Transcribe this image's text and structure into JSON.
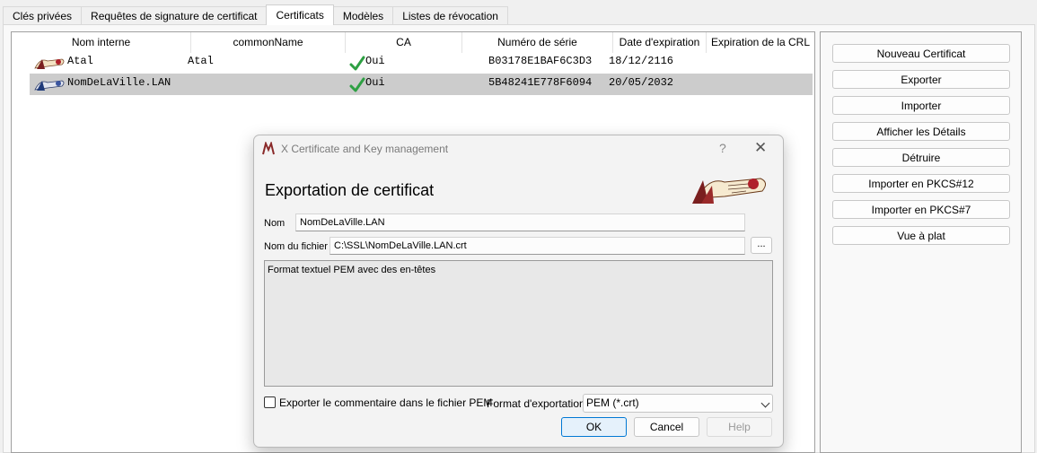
{
  "tabs": [
    "Clés privées",
    "Requêtes de signature de certificat",
    "Certificats",
    "Modèles",
    "Listes de révocation"
  ],
  "active_tab": "Certificats",
  "columns": [
    "Nom interne",
    "commonName",
    "CA",
    "Numéro de série",
    "Date d'expiration",
    "Expiration de la CRL"
  ],
  "rows": [
    {
      "name": "Atal",
      "common_name": "Atal",
      "ca": "Oui",
      "serial": "B03178E1BAF6C3D3",
      "expiration": "18/12/2116",
      "crl": "",
      "selected": false
    },
    {
      "name": "NomDeLaVille.LAN",
      "common_name": "",
      "ca": "Oui",
      "serial": "5B48241E778F6094",
      "expiration": "20/05/2032",
      "crl": "",
      "selected": true
    }
  ],
  "actions": [
    "Nouveau Certificat",
    "Exporter",
    "Importer",
    "Afficher les Détails",
    "Détruire",
    "Importer en PKCS#12",
    "Importer en PKCS#7",
    "Vue à plat"
  ],
  "dialog": {
    "title": "X Certificate and Key management",
    "help_glyph": "?",
    "close_glyph": "✕",
    "heading": "Exportation de certificat",
    "name_label": "Nom",
    "name_value": "NomDeLaVille.LAN",
    "file_label": "Nom du fichier",
    "file_value": "C:\\SSL\\NomDeLaVille.LAN.crt",
    "browse_label": "...",
    "description": "Format textuel PEM avec des en-têtes",
    "comment_checkbox_label": "Exporter le commentaire dans le fichier PEM",
    "comment_checked": false,
    "format_label": "Format d'exportation",
    "format_value": "PEM (*.crt)",
    "ok": "OK",
    "cancel": "Cancel",
    "help": "Help"
  },
  "colors": {
    "accent": "#0078d4",
    "selection": "#cccccc",
    "check": "#2ea043"
  },
  "icons": {
    "certificate_row": "certificate-scroll-icon",
    "ca_flag": "checkmark-icon",
    "app_logo": "xca-logo-icon"
  }
}
